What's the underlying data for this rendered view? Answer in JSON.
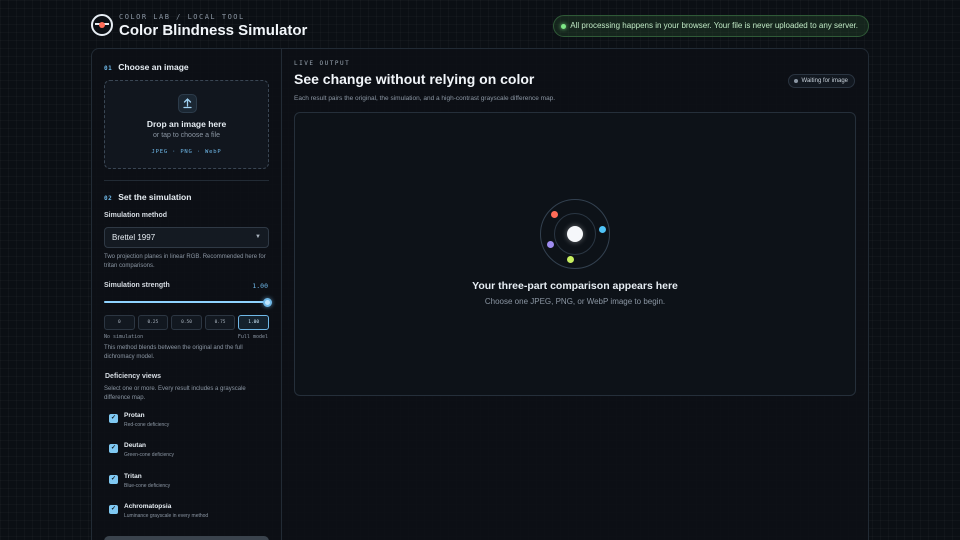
{
  "header": {
    "eyebrow": "COLOR LAB / LOCAL TOOL",
    "title": "Color Blindness Simulator",
    "privacy_note": "All processing happens in your browser. Your file is never uploaded to any server."
  },
  "upload": {
    "step": "01",
    "heading": "Choose an image",
    "drop_title": "Drop an image here",
    "drop_sub": "or tap to choose a file",
    "formats": "JPEG · PNG · WebP"
  },
  "simulation": {
    "step": "02",
    "heading": "Set the simulation",
    "method_label": "Simulation method",
    "method_value": "Brettel 1997",
    "method_help": "Two projection planes in linear RGB. Recommended here for tritan comparisons.",
    "strength_label": "Simulation strength",
    "strength_value": "1.00",
    "strength_fraction": 1.0,
    "presets": [
      "0",
      "0.25",
      "0.50",
      "0.75",
      "1.00"
    ],
    "active_preset": 4,
    "scale_min": "No simulation",
    "scale_max": "Full model",
    "strength_help": "This method blends between the original and the full dichromacy model."
  },
  "deficiency": {
    "heading": "Deficiency views",
    "help": "Select one or more. Every result includes a grayscale difference map.",
    "items": [
      {
        "title": "Protan",
        "desc": "Red-cone deficiency",
        "checked": true
      },
      {
        "title": "Deutan",
        "desc": "Green-cone deficiency",
        "checked": true
      },
      {
        "title": "Tritan",
        "desc": "Blue-cone deficiency",
        "checked": true
      },
      {
        "title": "Achromatopsia",
        "desc": "Luminance grayscale in every method",
        "checked": true
      }
    ]
  },
  "output": {
    "eyebrow": "LIVE OUTPUT",
    "title": "See change without relying on color",
    "description": "Each result pairs the original, the simulation, and a high-contrast grayscale difference map.",
    "status": "Waiting for image",
    "empty_title": "Your three-part comparison appears here",
    "empty_sub": "Choose one JPEG, PNG, or WebP image to begin."
  },
  "colors": {
    "accent": "#6fb8e8",
    "success": "#7ee787",
    "orbit_red": "#ff6b57",
    "orbit_blue": "#4fc3f7",
    "orbit_purple": "#9f8cf0",
    "orbit_green": "#c8f060"
  },
  "icons": {
    "logo": "eye-slash-logo-icon",
    "upload": "upload-arrow-icon",
    "chevron": "chevron-down-icon",
    "check": "check-icon"
  }
}
